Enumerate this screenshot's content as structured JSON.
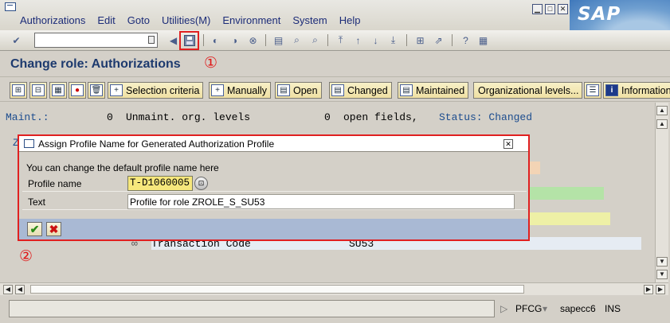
{
  "menu": [
    "Authorizations",
    "Edit",
    "Goto",
    "Utilities(M)",
    "Environment",
    "System",
    "Help"
  ],
  "sap_logo": "SAP",
  "page_title": "Change role: Authorizations",
  "annotations": {
    "one": "①",
    "two": "②"
  },
  "app_toolbar": {
    "selection_criteria": "Selection criteria",
    "manually": "Manually",
    "open": "Open",
    "changed": "Changed",
    "maintained": "Maintained",
    "org_levels": "Organizational levels...",
    "information": "Information"
  },
  "summary": {
    "maint_label": "Maint.:",
    "maint_count": "0",
    "unmaint_label": "Unmaint. org. levels",
    "unmaint_count": "0",
    "open_fields": "open fields,",
    "status": "Status: Changed",
    "row2_prefix": "Z"
  },
  "tree_row": {
    "label": "Transaction Code",
    "value": "SU53"
  },
  "dialog": {
    "title": "Assign Profile Name for Generated Authorization Profile",
    "message": "You can change the default profile name here",
    "profile_name_label": "Profile name",
    "profile_name_value": "T-D1060005",
    "text_label": "Text",
    "text_value": "Profile for role ZROLE_S_SU53"
  },
  "status_bar": {
    "transaction": "PFCG",
    "system": "sapecc6",
    "mode": "INS"
  },
  "colors": {
    "accent_red": "#e02020",
    "title_blue": "#1d3a6e",
    "dialog_footer": "#a9b9d4"
  }
}
